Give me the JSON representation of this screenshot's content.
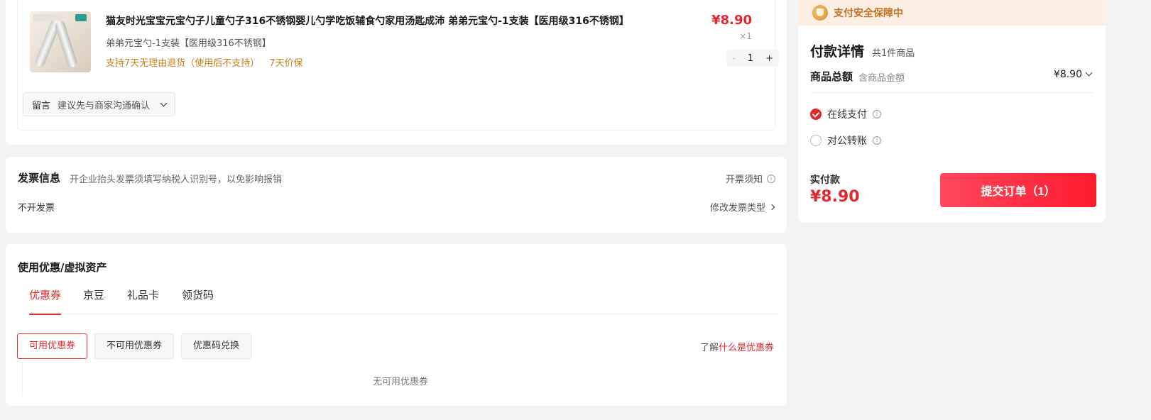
{
  "product": {
    "title": "猫友时光宝宝元宝勺子儿童勺子316不锈钢婴儿勺学吃饭辅食勺家用汤匙成沛 弟弟元宝勺-1支装【医用级316不锈钢】",
    "spec": "弟弟元宝勺-1支装【医用级316不锈钢】",
    "service_return": "支持7天无理由退货（使用后不支持）",
    "service_price_protect": "7天价保",
    "price": "¥8.90",
    "quantity_text": "×1",
    "stepper": {
      "minus": "-",
      "value": "1",
      "plus": "+"
    },
    "message": {
      "label": "留言",
      "hint": "建议先与商家沟通确认"
    }
  },
  "invoice": {
    "title": "发票信息",
    "hint": "开企业抬头发票须填写纳税人识别号，以免影响报销",
    "notice": "开票须知",
    "value": "不开发票",
    "change": "修改发票类型"
  },
  "coupon": {
    "title": "使用优惠/虚拟资产",
    "tabs": [
      "优惠券",
      "京豆",
      "礼品卡",
      "领货码"
    ],
    "buttons": [
      "可用优惠券",
      "不可用优惠券",
      "优惠码兑换"
    ],
    "learn_prefix": "了解",
    "learn_link": "什么是优惠券",
    "empty": "无可用优惠券"
  },
  "payment": {
    "banner": "支付安全保障中",
    "title": "付款详情",
    "count": "共1件商品",
    "total_label": "商品总额",
    "total_sub": "含商品金额",
    "total_value": "¥8.90",
    "option_online": "在线支付",
    "option_transfer": "对公转账",
    "actual_label": "实付款",
    "actual_value": "¥8.90",
    "submit": "提交订单（1）"
  },
  "colors": {
    "accent": "#e4262d",
    "service": "#c8801c",
    "banner_bg": "#fdeee3"
  }
}
